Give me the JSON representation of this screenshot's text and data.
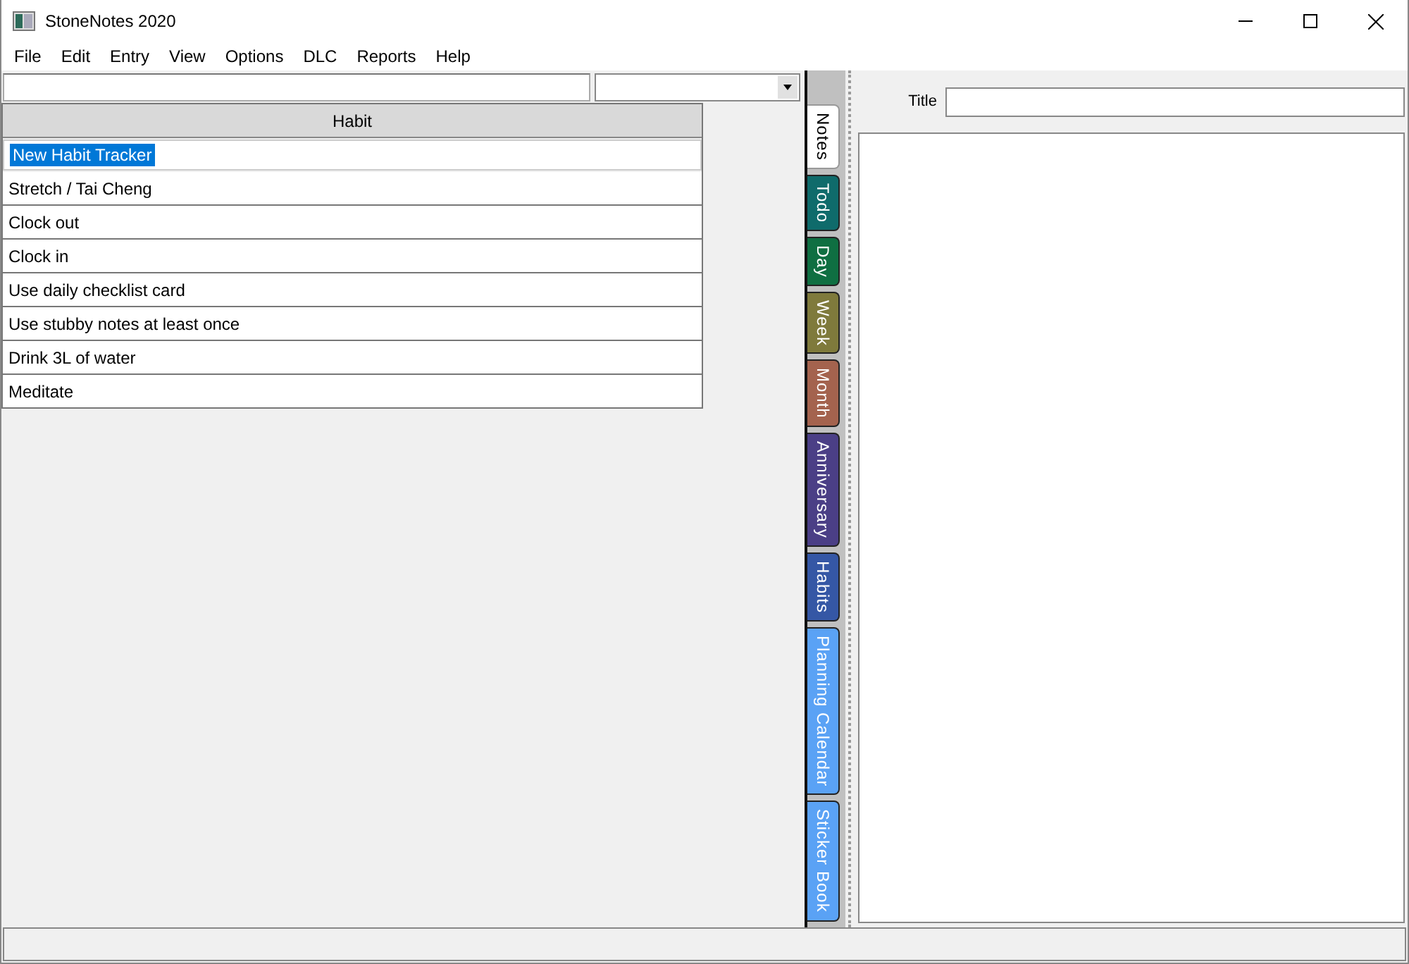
{
  "window": {
    "title": "StoneNotes 2020"
  },
  "menu": [
    "File",
    "Edit",
    "Entry",
    "View",
    "Options",
    "DLC",
    "Reports",
    "Help"
  ],
  "table": {
    "columns": [
      "Habit"
    ],
    "rows": [
      {
        "cells": [
          "New Habit Tracker"
        ],
        "selected": true
      },
      {
        "cells": [
          "Stretch / Tai Cheng"
        ],
        "selected": false
      },
      {
        "cells": [
          "Clock out"
        ],
        "selected": false
      },
      {
        "cells": [
          "Clock in"
        ],
        "selected": false
      },
      {
        "cells": [
          "Use daily checklist card"
        ],
        "selected": false
      },
      {
        "cells": [
          "Use stubby notes at least once"
        ],
        "selected": false
      },
      {
        "cells": [
          "Drink 3L of water"
        ],
        "selected": false
      },
      {
        "cells": [
          "Meditate"
        ],
        "selected": false
      }
    ]
  },
  "tabs": [
    {
      "label": "Notes",
      "selected": true,
      "color": "#ffffff"
    },
    {
      "label": "Todo",
      "selected": false,
      "color": "#0f6b6b"
    },
    {
      "label": "Day",
      "selected": false,
      "color": "#0f6f42"
    },
    {
      "label": "Week",
      "selected": false,
      "color": "#7f7a3c"
    },
    {
      "label": "Month",
      "selected": false,
      "color": "#a4634e"
    },
    {
      "label": "Anniversary",
      "selected": false,
      "color": "#4b3f86"
    },
    {
      "label": "Habits",
      "selected": false,
      "color": "#3557a5"
    },
    {
      "label": "Planning Calendar",
      "selected": false,
      "color": "#5aa2f5"
    },
    {
      "label": "Sticker Book",
      "selected": false,
      "color": "#5aa2f5"
    }
  ],
  "editor": {
    "title_label": "Title"
  }
}
